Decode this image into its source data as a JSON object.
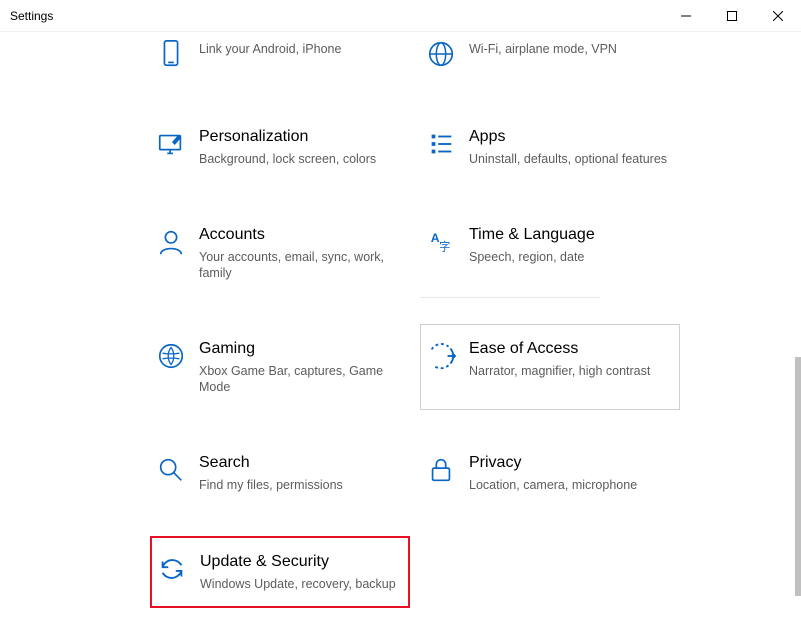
{
  "window": {
    "title": "Settings"
  },
  "categories": [
    {
      "id": "phone",
      "icon": "phone-icon",
      "title": "",
      "desc": "Link your Android, iPhone"
    },
    {
      "id": "network",
      "icon": "globe-icon",
      "title": "",
      "desc": "Wi-Fi, airplane mode, VPN"
    },
    {
      "id": "personalization",
      "icon": "personalization-icon",
      "title": "Personalization",
      "desc": "Background, lock screen, colors"
    },
    {
      "id": "apps",
      "icon": "apps-icon",
      "title": "Apps",
      "desc": "Uninstall, defaults, optional features"
    },
    {
      "id": "accounts",
      "icon": "accounts-icon",
      "title": "Accounts",
      "desc": "Your accounts, email, sync, work, family"
    },
    {
      "id": "time",
      "icon": "time-language-icon",
      "title": "Time & Language",
      "desc": "Speech, region, date"
    },
    {
      "id": "gaming",
      "icon": "gaming-icon",
      "title": "Gaming",
      "desc": "Xbox Game Bar, captures, Game Mode"
    },
    {
      "id": "ease",
      "icon": "ease-of-access-icon",
      "title": "Ease of Access",
      "desc": "Narrator, magnifier, high contrast"
    },
    {
      "id": "search",
      "icon": "search-icon",
      "title": "Search",
      "desc": "Find my files, permissions"
    },
    {
      "id": "privacy",
      "icon": "privacy-icon",
      "title": "Privacy",
      "desc": "Location, camera, microphone"
    },
    {
      "id": "update",
      "icon": "update-security-icon",
      "title": "Update & Security",
      "desc": "Windows Update, recovery, backup"
    }
  ],
  "hover_id": "ease",
  "highlight_id": "update",
  "colors": {
    "accent": "#0a66c4",
    "highlight": "#e81123",
    "text_muted": "#5c5c5c"
  }
}
